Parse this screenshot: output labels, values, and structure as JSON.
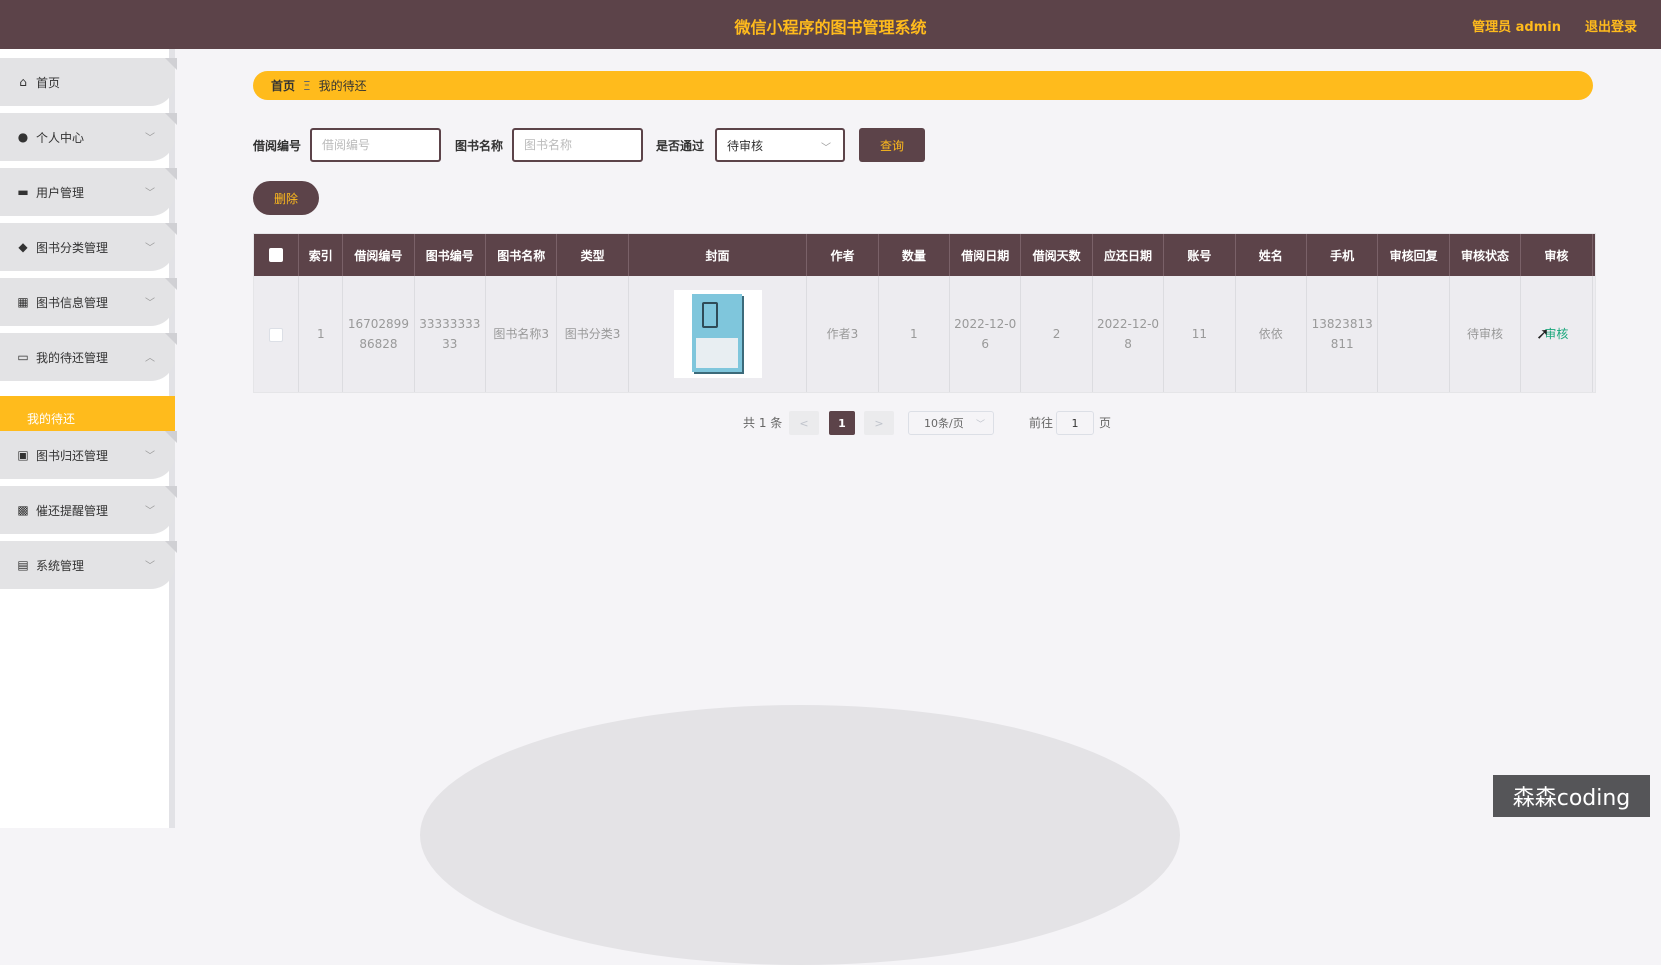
{
  "header": {
    "title": "微信小程序的图书管理系统",
    "admin": "管理员 admin",
    "logout": "退出登录"
  },
  "sidebar": {
    "items": [
      {
        "label": "首页",
        "icon": "home-icon",
        "glyph": "⌂"
      },
      {
        "label": "个人中心",
        "icon": "user-icon",
        "glyph": "●"
      },
      {
        "label": "用户管理",
        "icon": "monitor-icon",
        "glyph": "▬"
      },
      {
        "label": "图书分类管理",
        "icon": "pin-icon",
        "glyph": "◆"
      },
      {
        "label": "图书信息管理",
        "icon": "grid-icon",
        "glyph": "▦"
      },
      {
        "label": "我的待还管理",
        "icon": "chat-icon",
        "glyph": "▭"
      },
      {
        "label": "图书归还管理",
        "icon": "clipboard-x-icon",
        "glyph": "▣"
      },
      {
        "label": "催还提醒管理",
        "icon": "apps-icon",
        "glyph": "▩"
      },
      {
        "label": "系统管理",
        "icon": "clipboard-icon",
        "glyph": "▤"
      }
    ],
    "active_sub": "我的待还"
  },
  "breadcrumb": {
    "home": "首页",
    "separator": "Ξ",
    "current": "我的待还"
  },
  "search": {
    "borrow_no_label": "借阅编号",
    "borrow_no_placeholder": "借阅编号",
    "book_name_label": "图书名称",
    "book_name_placeholder": "图书名称",
    "approved_label": "是否通过",
    "approved_value": "待审核",
    "query_button": "查询"
  },
  "actions": {
    "delete_button": "删除"
  },
  "table": {
    "headers": [
      "索引",
      "借阅编号",
      "图书编号",
      "图书名称",
      "类型",
      "封面",
      "作者",
      "数量",
      "借阅日期",
      "借阅天数",
      "应还日期",
      "账号",
      "姓名",
      "手机",
      "审核回复",
      "审核状态",
      "审核"
    ],
    "rows": [
      {
        "index": "1",
        "borrow_no": "1670289986828",
        "book_no": "3333333333",
        "book_name": "图书名称3",
        "type": "图书分类3",
        "author": "作者3",
        "quantity": "1",
        "borrow_date": "2022-12-06",
        "borrow_days": "2",
        "due_date": "2022-12-08",
        "account": "11",
        "name": "依依",
        "phone": "13823813811",
        "reply": "",
        "status": "待审核",
        "review": "审核"
      }
    ]
  },
  "pagination": {
    "total": "共 1 条",
    "prev": "<",
    "current": "1",
    "next": ">",
    "page_size": "10条/页",
    "goto_label": "前往",
    "goto_value": "1",
    "page_suffix": "页"
  },
  "watermark": "森森coding",
  "colors": {
    "brand": "#5c4349",
    "accent": "#ffbb1c",
    "link": "#1ba77c"
  }
}
